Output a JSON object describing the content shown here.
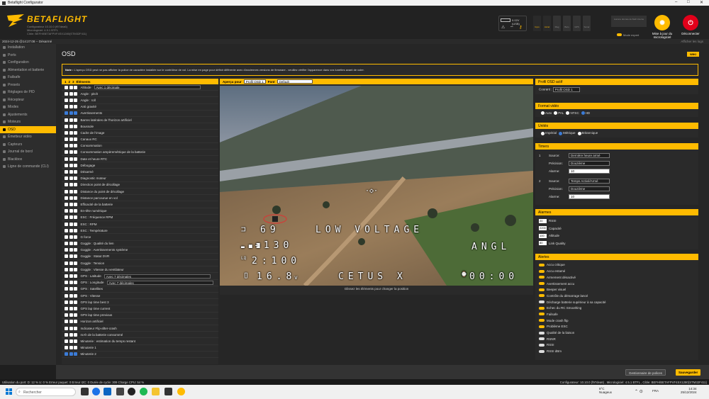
{
  "window": {
    "title": "Betaflight Configurator"
  },
  "header": {
    "brand": "BETAFLIGHT",
    "ver1": "Configurateur 10.10.0 (f97dea6)",
    "ver2": "Micrologiciel: 4.5.1 BTFL",
    "ver3": "Cible: BEFH/BETAFPVF4SX1280(STM32F411)",
    "battery": "0.02V (USB)",
    "sensors": [
      "Gyro",
      "Accel",
      "Mag",
      "Baro",
      "GPS",
      "Sonar"
    ],
    "expert_notice": "Aucune donnée de flash interne",
    "expert_mode": "Mode expert",
    "flash_button": "Mise à jour du micrologiciel",
    "disconnect_button": "Déconnecter"
  },
  "strip": {
    "datetime": "2024-12-25 @14:27:08 -- Désarmé",
    "logs": "Afficher les logs"
  },
  "nav": {
    "items": [
      "Installation",
      "Ports",
      "Configuration",
      "Alimentation et batterie",
      "Failsafe",
      "Presets",
      "Réglages de PID",
      "Récepteur",
      "Modes",
      "Ajustements",
      "Moteurs",
      "OSD",
      "Émetteur vidéo",
      "Capteurs",
      "Journal de bord",
      "Blackbox",
      "Ligne de commande (CLI)"
    ],
    "active": 11
  },
  "page": {
    "title": "OSD",
    "wiki": "WIKI",
    "note_bold": "Note :",
    "note": "L'aperçu OSD peut ne pas afficher la police de caractère installée sur le contrôleur de vol. La mise en page pour définir différente avec d'anciennes versions de firmware - veuillez vérifier l'apparence dans vos lunettes avant de voler."
  },
  "elements": {
    "header": "Éléments",
    "profiles": [
      "1",
      "2",
      "3"
    ],
    "rows": [
      {
        "label": "Altitude",
        "select": "Avec 1 décimale",
        "on": false
      },
      {
        "label": "Angle : pitch",
        "on": false
      },
      {
        "label": "Angle : roll",
        "on": false
      },
      {
        "label": "Anti gravité",
        "on": false
      },
      {
        "label": "Avertissements",
        "on": true
      },
      {
        "label": "Barres latérales de l'horizon artificiel",
        "on": false
      },
      {
        "label": "Boussole",
        "on": false
      },
      {
        "label": "Cadre de l'image",
        "on": false
      },
      {
        "label": "Canaux RC",
        "on": false
      },
      {
        "label": "Consommation",
        "on": false
      },
      {
        "label": "Consommation ampèremétrique de la batterie",
        "on": false
      },
      {
        "label": "Date et heure RTC",
        "on": false
      },
      {
        "label": "Débogage",
        "on": false
      },
      {
        "label": "Désarmé",
        "on": false
      },
      {
        "label": "Diagnostic moteur",
        "on": false
      },
      {
        "label": "Direction point de décollage",
        "on": false
      },
      {
        "label": "Distance du point de décollage",
        "on": false
      },
      {
        "label": "Distance parcourue en vol",
        "on": false
      },
      {
        "label": "Efficacité de la batterie",
        "on": false
      },
      {
        "label": "En-tête numérique",
        "on": false
      },
      {
        "label": "ESC : Fréquence RPM",
        "on": false
      },
      {
        "label": "ESC : RPM",
        "on": false
      },
      {
        "label": "ESC : Température",
        "on": false
      },
      {
        "label": "G force",
        "on": false
      },
      {
        "label": "Goggle : Qualité du lien",
        "on": false
      },
      {
        "label": "Goggle : Avertissements système",
        "on": false
      },
      {
        "label": "Goggle : Statut DVR",
        "on": false
      },
      {
        "label": "Goggle : Tension",
        "on": false
      },
      {
        "label": "Goggle : Vitesse du ventilateur",
        "on": false
      },
      {
        "label": "GPS : Latitude",
        "select": "Avec 7 décimales",
        "on": false
      },
      {
        "label": "GPS : Longitude",
        "select": "Avec 7 décimales",
        "on": false
      },
      {
        "label": "GPS : Satellites",
        "on": false
      },
      {
        "label": "GPS : Vitesse",
        "on": false
      },
      {
        "label": "GPS lap time best 3",
        "on": false
      },
      {
        "label": "GPS lap time current",
        "on": false
      },
      {
        "label": "GPS lap time previous",
        "on": false
      },
      {
        "label": "Horizon artificiel",
        "on": false
      },
      {
        "label": "Indicateur Flip-after-crash",
        "on": false
      },
      {
        "label": "mAh de la batterie consommé",
        "on": false
      },
      {
        "label": "Minuterie : estimation du temps restant",
        "on": false
      },
      {
        "label": "Minuterie 1",
        "on": false
      },
      {
        "label": "Minuterie 2",
        "on": true
      }
    ]
  },
  "preview": {
    "label": "Aperçu pour",
    "profile": "Profil OSD 1",
    "font_label": "Font",
    "font": "Default",
    "caption": "Glissez les éléments pour changer la position",
    "osd": {
      "ch": "69",
      "warning": "LOW VOLTAGE",
      "altitude": "-130",
      "angl": "ANGL",
      "lq": "2:100",
      "voltage": "16.8",
      "volt_unit": "v",
      "name": "CETUS X",
      "timer": "00:00"
    }
  },
  "profile_panel": {
    "title": "Profil OSD actif",
    "label": "Courant :",
    "value": "Profil OSD 1"
  },
  "video": {
    "title": "Format vidéo",
    "options": [
      "Auto",
      "PAL",
      "NTSC",
      "HD"
    ],
    "selected": 3
  },
  "units": {
    "title": "Unités",
    "options": [
      "Impérial",
      "Métrique",
      "Britannique"
    ],
    "selected": 1
  },
  "timers": {
    "title": "Timers",
    "items": [
      {
        "n": "1",
        "source": "Dernière heure armé",
        "precision": "Douzième",
        "alarm": "10"
      },
      {
        "n": "2",
        "source": "Temps Activé/Armé",
        "precision": "Douzième",
        "alarm": "10"
      }
    ],
    "source_label": "Source:",
    "precision_label": "Précision:",
    "alarm_label": "Alarme:"
  },
  "alarms": {
    "title": "Alarmes",
    "items": [
      {
        "v": "20",
        "l": "RSSI"
      },
      {
        "v": "2200",
        "l": "Capacité"
      },
      {
        "v": "100",
        "l": "Altitude"
      },
      {
        "v": "80",
        "l": "Link Quality"
      }
    ]
  },
  "alerts": {
    "title": "Alertes",
    "items": [
      {
        "l": "Accu critique",
        "on": true
      },
      {
        "l": "Accu entamé",
        "on": true
      },
      {
        "l": "Armement désactivé",
        "on": true
      },
      {
        "l": "Avertissement accu",
        "on": true
      },
      {
        "l": "Beeper visuel",
        "on": true
      },
      {
        "l": "Contrôle du démarrage lancé",
        "on": true
      },
      {
        "l": "Décharge batterie supérieur à sa capacité",
        "on": false
      },
      {
        "l": "Echec du RC Smoothing",
        "on": true
      },
      {
        "l": "Failsafe",
        "on": true
      },
      {
        "l": "Mode crash flip",
        "on": true
      },
      {
        "l": "Problème ESC",
        "on": true
      },
      {
        "l": "Qualité de la liaison",
        "on": false
      },
      {
        "l": "RSNR",
        "on": false
      },
      {
        "l": "RSSI",
        "on": false
      },
      {
        "l": "RSSI dBm",
        "on": false
      }
    ]
  },
  "footer": {
    "font_manager": "Gestionnaire de polices",
    "save": "Sauvegarder"
  },
  "statusbar": {
    "left": "Utilisation du port: D: 12 % U: 0 %    Erreur paquet: 0    Erreur I2C: 0    Durée de cycle: 309    Charge CPU: 54 %",
    "right": "Configurateur: 10.10.0 (f97dea6) , Micrologiciel: 4.5.1 BTFL , Cible: BEFH/BETAFPVF4SX1280(STM32F411)"
  },
  "taskbar": {
    "search": "Rechercher",
    "weather": "8°C",
    "weather2": "Nuageux",
    "lang": "FRA",
    "time": "14:34",
    "date": "25/12/2024"
  },
  "colors": {
    "accent": "#ffbb00",
    "panel": "#2a2a2a",
    "checkbox_on": "#3b7bd6"
  }
}
